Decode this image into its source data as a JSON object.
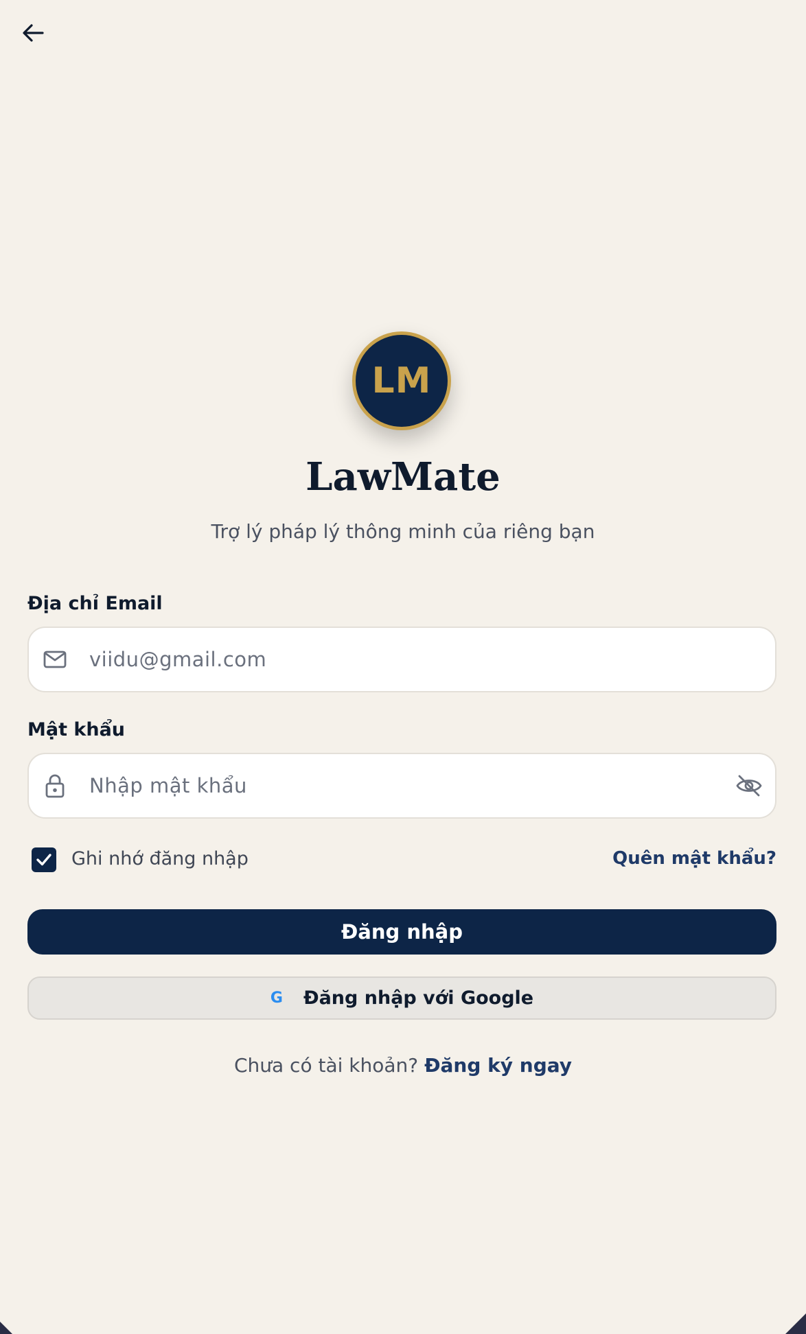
{
  "header": {
    "back_icon": "arrow-left-icon"
  },
  "brand": {
    "logo_initials": "LM",
    "app_name": "LawMate",
    "tagline": "Trợ lý pháp lý thông minh của riêng bạn",
    "navy": "#0d2547",
    "gold": "#c9a24c"
  },
  "form": {
    "email_label": "Địa chỉ Email",
    "email_placeholder": "viidu@gmail.com",
    "email_icon": "mail-icon",
    "password_label": "Mật khẩu",
    "password_placeholder": "Nhập mật khẩu",
    "password_icon": "lock-icon",
    "visibility_icon": "eye-off-icon",
    "remember_label": "Ghi nhớ đăng nhập",
    "remember_checked": true,
    "forgot_link": "Quên mật khẩu?"
  },
  "actions": {
    "login_label": "Đăng nhập",
    "google_label": "Đăng nhập với Google",
    "google_icon": "google-icon"
  },
  "footer": {
    "signup_prompt": "Chưa có tài khoản?",
    "signup_link": "Đăng ký ngay"
  }
}
